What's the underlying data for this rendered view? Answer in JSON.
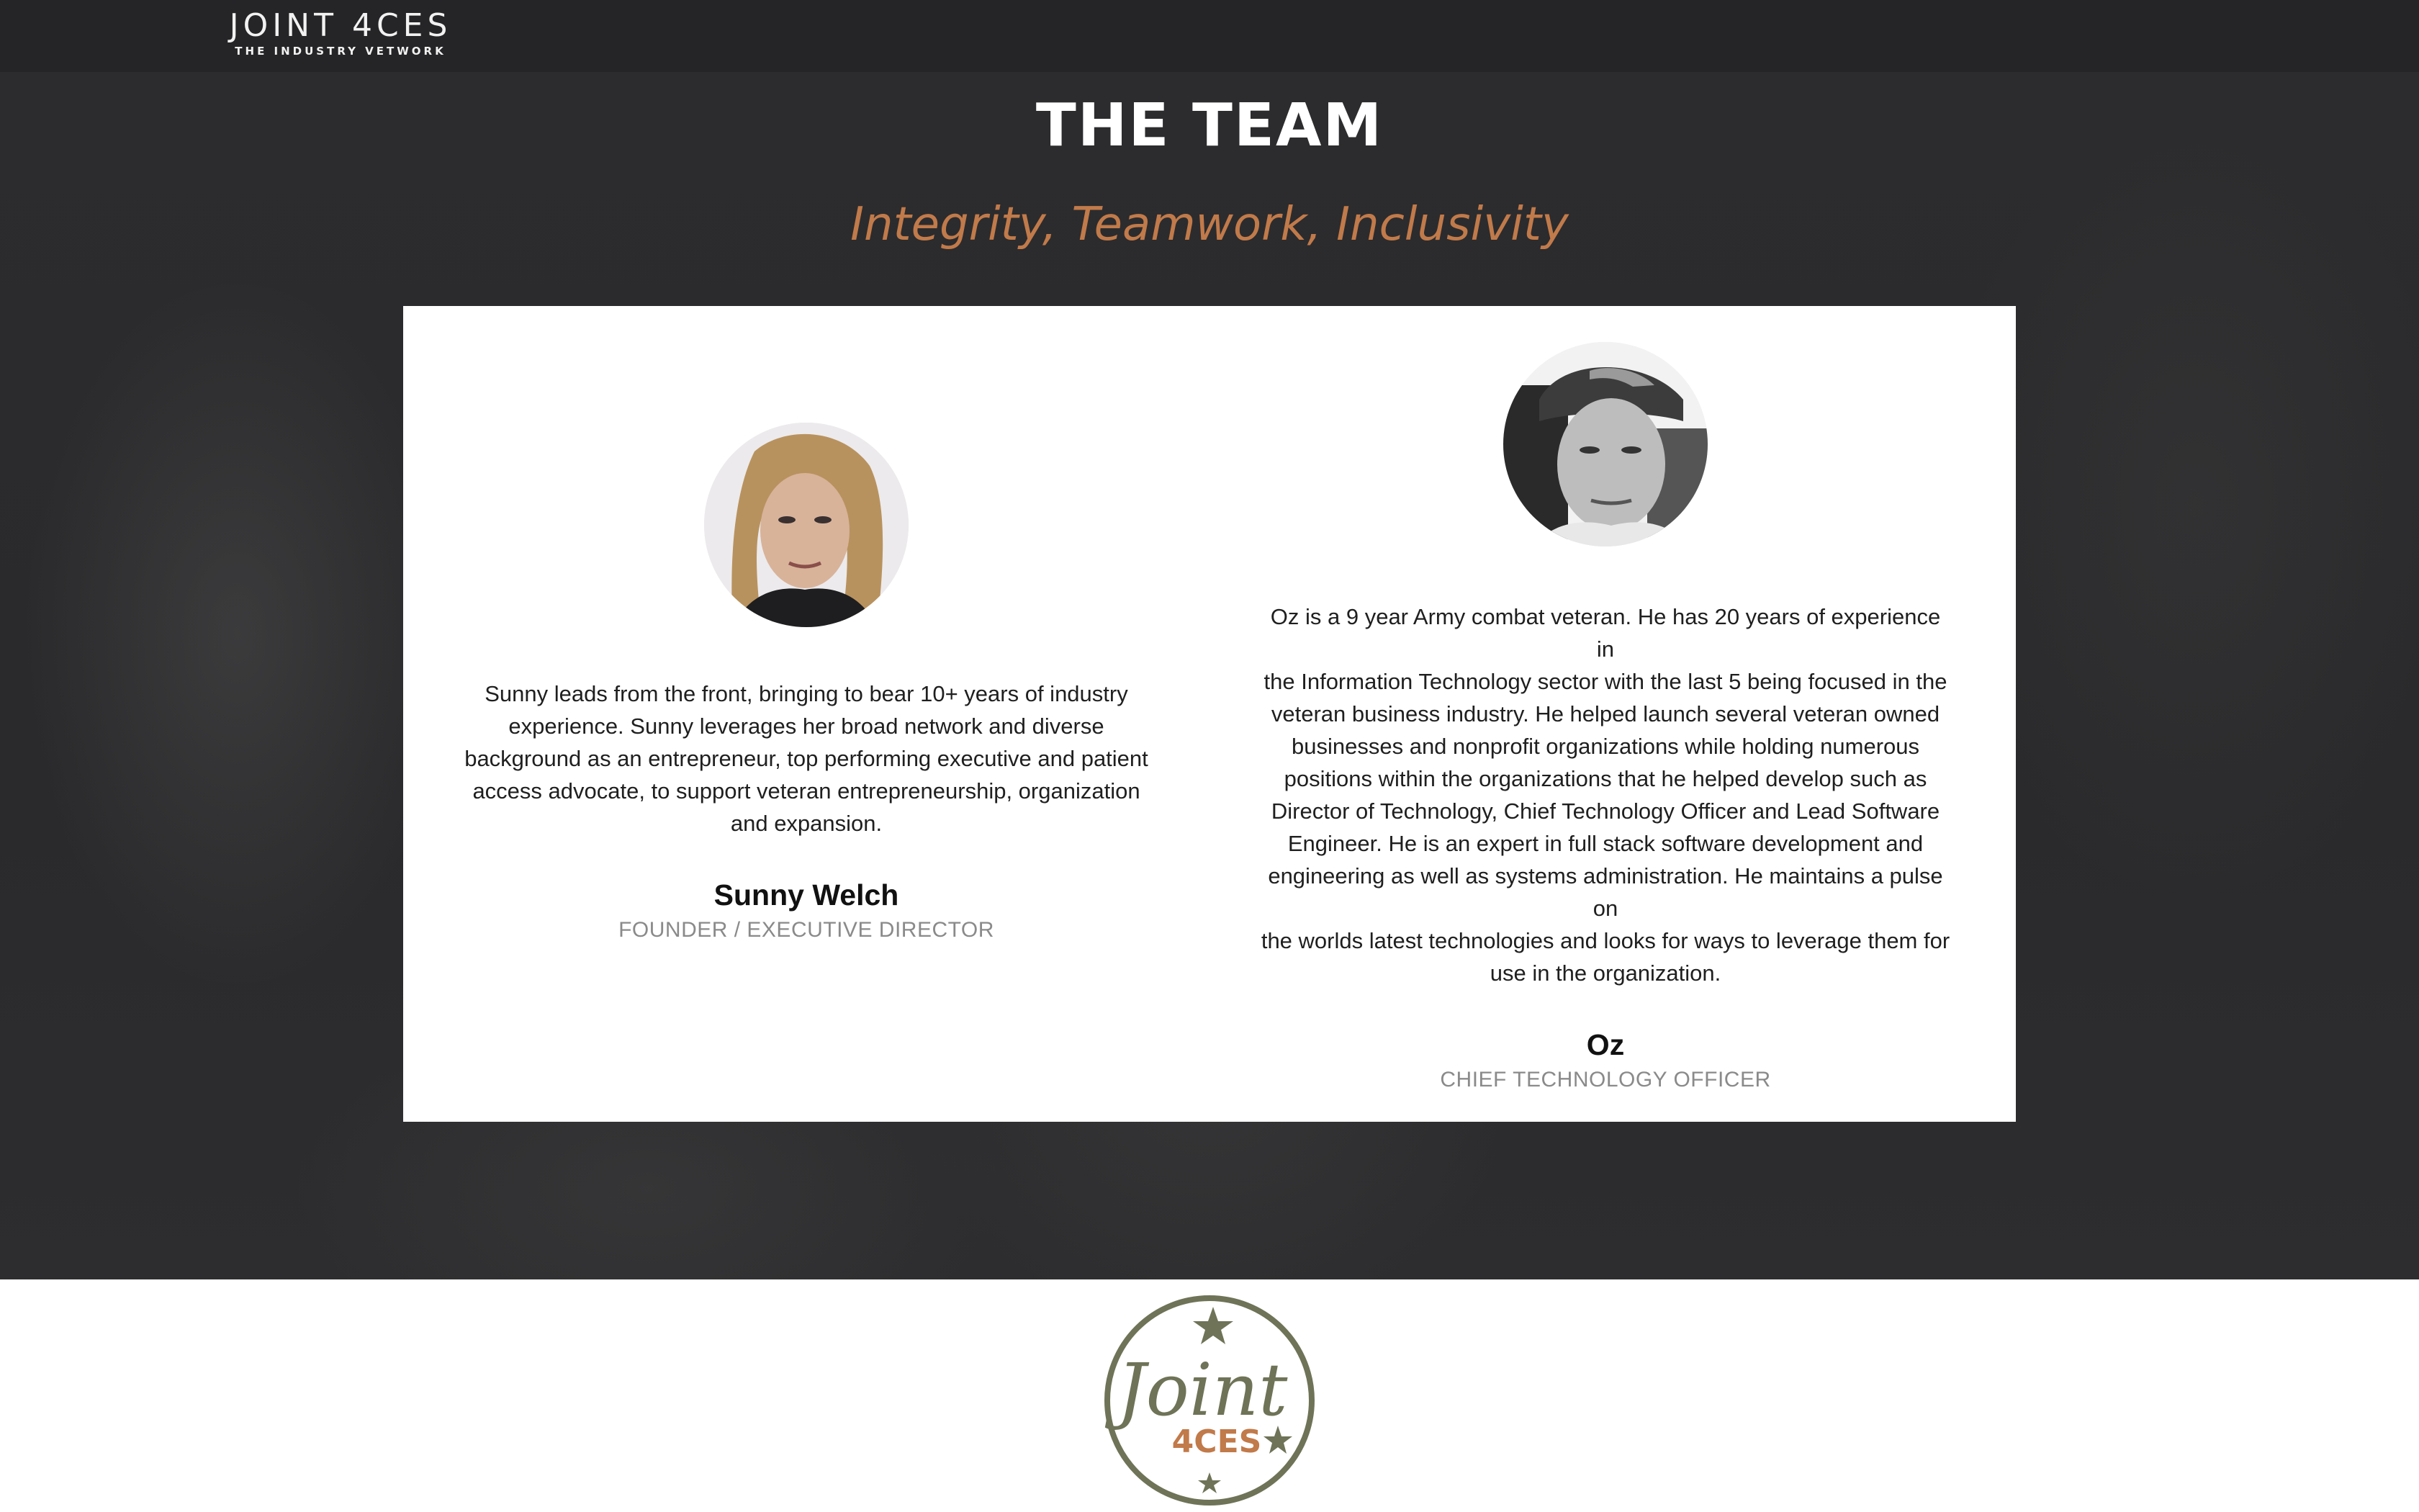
{
  "header": {
    "logo_main": "JOINT 4CES",
    "logo_sub": "THE INDUSTRY VETWORK"
  },
  "section": {
    "title": "THE TEAM",
    "tagline": "Integrity, Teamwork, Inclusivity"
  },
  "team": [
    {
      "name": "Sunny Welch",
      "role": "FOUNDER / EXECUTIVE DIRECTOR",
      "bio_lines": [
        "Sunny leads from the front, bringing to bear 10+ years of industry",
        "experience. Sunny leverages her broad network and diverse",
        "background as an entrepreneur, top performing executive and patient",
        "access advocate, to support veteran entrepreneurship, organization",
        "and expansion."
      ]
    },
    {
      "name": "Oz",
      "role": "CHIEF TECHNOLOGY OFFICER",
      "bio_lines": [
        "Oz is a 9 year Army combat veteran. He has 20 years of experience in",
        "the Information Technology sector with the last 5 being focused in the",
        "veteran business industry. He helped launch several veteran owned",
        "businesses and nonprofit organizations while holding numerous",
        "positions within the organizations that he helped develop such as",
        "Director of Technology, Chief Technology Officer and Lead Software",
        "Engineer. He is an expert in full stack software development and",
        "engineering as well as systems administration. He maintains a pulse on",
        "the worlds latest technologies and looks for ways to leverage them for",
        "use in the organization."
      ]
    }
  ],
  "footer": {
    "logo_script": "Joint",
    "logo_text": "4CES"
  },
  "colors": {
    "accent": "#c17a4a",
    "logo_green": "#6f7357",
    "background": "#2c2c2e"
  }
}
